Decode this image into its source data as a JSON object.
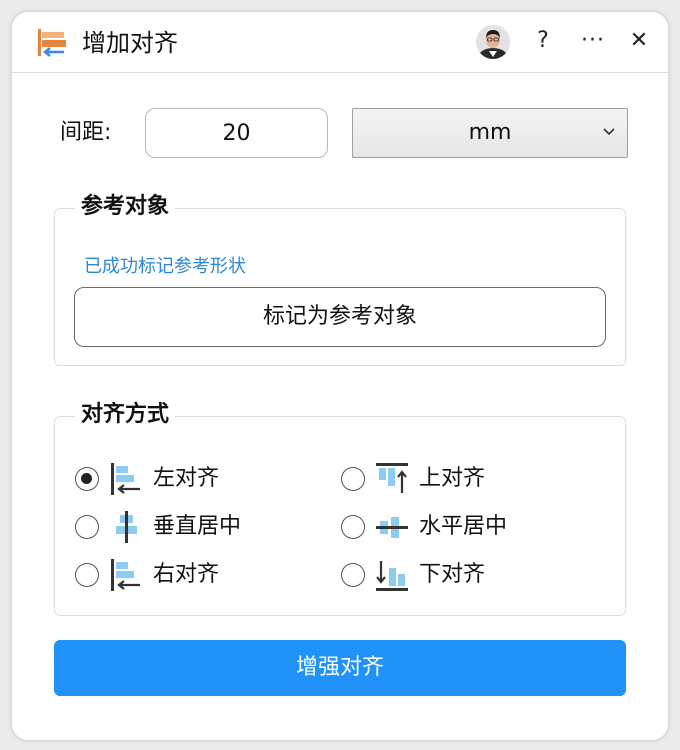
{
  "window": {
    "title": "增加对齐",
    "help_label": "?",
    "more_label": "···",
    "close_label": "✕"
  },
  "spacing": {
    "label": "间距:",
    "value": "20",
    "unit": "mm"
  },
  "reference": {
    "group_title": "参考对象",
    "status_text": "已成功标记参考形状",
    "mark_button": "标记为参考对象"
  },
  "alignment": {
    "group_title": "对齐方式",
    "options": [
      {
        "label": "左对齐",
        "icon": "align-left-icon",
        "checked": true
      },
      {
        "label": "上对齐",
        "icon": "align-top-icon",
        "checked": false
      },
      {
        "label": "垂直居中",
        "icon": "align-vertical-center-icon",
        "checked": false
      },
      {
        "label": "水平居中",
        "icon": "align-horizontal-center-icon",
        "checked": false
      },
      {
        "label": "右对齐",
        "icon": "align-right-icon",
        "checked": false
      },
      {
        "label": "下对齐",
        "icon": "align-bottom-icon",
        "checked": false
      }
    ]
  },
  "primary_button": "增强对齐",
  "colors": {
    "accent": "#2192f7",
    "status_text": "#2d86d6",
    "icon_blue": "#8ecbf0",
    "icon_dark": "#333333",
    "app_icon_orange": "#e8853c"
  }
}
